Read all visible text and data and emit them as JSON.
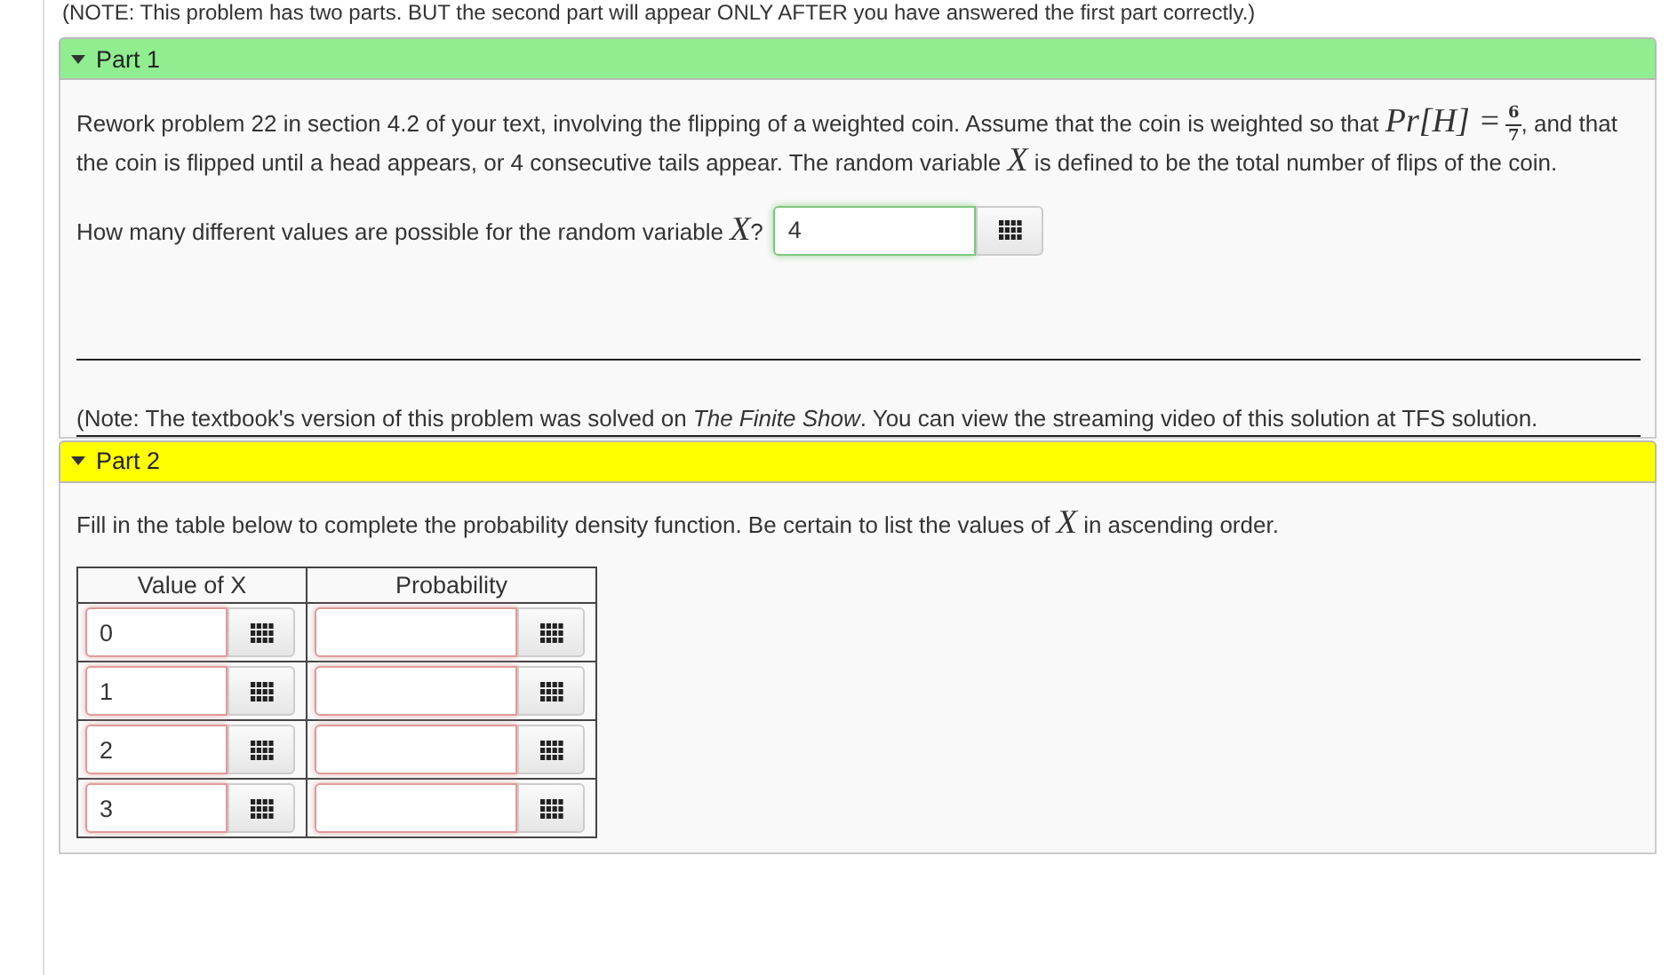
{
  "top_note": "(NOTE: This problem has two parts. BUT the second part will appear ONLY AFTER you have answered the first part correctly.)",
  "parts": [
    {
      "title": "Part 1",
      "expanded": true,
      "color": "#90ee90",
      "problem": [
        {
          "kind": "text",
          "text": "Rework problem 22 in section 4.2 of your text, involving the flipping of a weighted coin. Assume that the coin is weighted so that "
        },
        {
          "kind": "math",
          "text": "Pr[H] ="
        },
        {
          "kind": "frac",
          "num": "6",
          "den": "7"
        },
        {
          "kind": "text",
          "text": ", and that the coin is flipped until a head appears, or 4 consecutive tails appear. The random variable "
        },
        {
          "kind": "math",
          "text": "X"
        },
        {
          "kind": "text",
          "text": " is defined to be the total number of flips of the coin."
        }
      ],
      "question": [
        {
          "kind": "text",
          "text": "How many different values are possible for the random variable "
        },
        {
          "kind": "math",
          "text": "X"
        },
        {
          "kind": "text",
          "text": "?"
        }
      ],
      "answer": {
        "value": "4",
        "correct": true
      },
      "note": "(Note: The textbook's version of this problem was solved on *The Finite Show*. You can view the streaming video of this solution at TFS solution."
    },
    {
      "title": "Part 2",
      "expanded": true,
      "color": "#ffff00",
      "instruction": [
        {
          "kind": "text",
          "text": "Fill in the table below to complete the probability density function. Be certain to list the values of "
        },
        {
          "kind": "math",
          "text": "X"
        },
        {
          "kind": "text",
          "text": " in ascending order."
        }
      ],
      "table": {
        "columns": [
          "Value of X",
          "Probability"
        ],
        "rows": [
          {
            "value": {
              "value": "0",
              "correct": false
            },
            "probability": {
              "correct": false
            }
          },
          {
            "value": {
              "value": "1",
              "correct": false
            },
            "probability": {
              "correct": false
            }
          },
          {
            "value": {
              "value": "2",
              "correct": false
            },
            "probability": {
              "correct": false
            }
          },
          {
            "value": {
              "value": "3",
              "correct": false
            },
            "probability": {
              "correct": false
            }
          }
        ]
      }
    }
  ]
}
